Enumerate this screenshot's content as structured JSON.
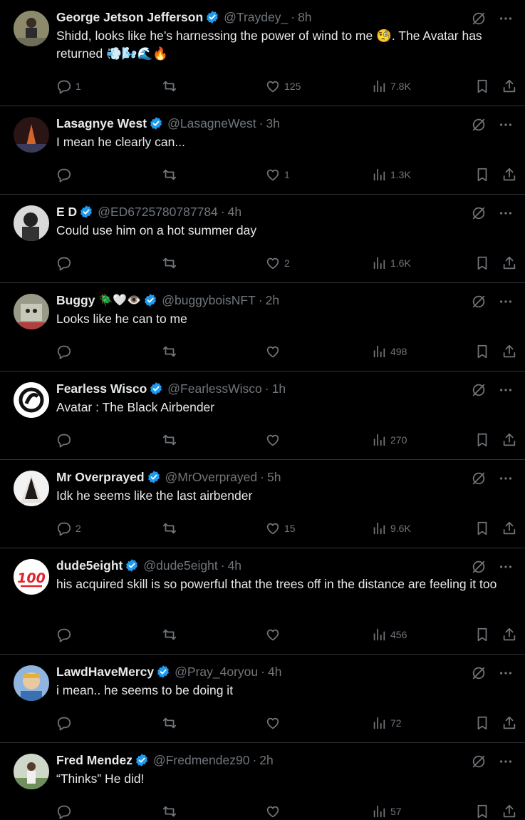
{
  "tweets": [
    {
      "name": "George Jetson Jefferson",
      "handle": "@Traydey_",
      "time": "8h",
      "name_emoji": "",
      "text": "Shidd, looks like he’s harnessing the power of wind to me 🧐.  The Avatar has returned 💨🌬️🌊🔥",
      "replies": "1",
      "retweets": "",
      "likes": "125",
      "views": "7.8K",
      "avatar_color": "#6b6b55"
    },
    {
      "name": "Lasagnye West",
      "handle": "@LasagneWest",
      "time": "3h",
      "name_emoji": "",
      "text": "I mean he clearly can...",
      "replies": "",
      "retweets": "",
      "likes": "1",
      "views": "1.3K",
      "avatar_color": "#3a2a2a"
    },
    {
      "name": "E D",
      "handle": "@ED6725780787784",
      "time": "4h",
      "name_emoji": "",
      "text": "Could use him on a hot summer day",
      "replies": "",
      "retweets": "",
      "likes": "2",
      "views": "1.6K",
      "avatar_color": "#444"
    },
    {
      "name": "Buggy",
      "handle": "@buggyboisNFT",
      "time": "2h",
      "name_emoji": "🪲🤍👁️",
      "text": "Looks like he can to me",
      "replies": "",
      "retweets": "",
      "likes": "",
      "views": "498",
      "avatar_color": "#8a8a7a"
    },
    {
      "name": "Fearless Wisco",
      "handle": "@FearlessWisco",
      "time": "1h",
      "name_emoji": "",
      "text": "Avatar : The Black Airbender",
      "replies": "",
      "retweets": "",
      "likes": "",
      "views": "270",
      "avatar_color": "#fff"
    },
    {
      "name": "Mr Overprayed",
      "handle": "@MrOverprayed",
      "time": "5h",
      "name_emoji": "",
      "text": "Idk he seems like the last airbender",
      "replies": "2",
      "retweets": "",
      "likes": "15",
      "views": "9.6K",
      "avatar_color": "#ddd"
    },
    {
      "name": "dude5eight",
      "handle": "@dude5eight",
      "time": "4h",
      "name_emoji": "",
      "text": "his acquired skill is so powerful that the trees off in the distance are feeling it too",
      "replies": "",
      "retweets": "",
      "likes": "",
      "views": "456",
      "avatar_color": "#fff"
    },
    {
      "name": "LawdHaveMercy",
      "handle": "@Pray_4oryou",
      "time": "4h",
      "name_emoji": "",
      "text": "i mean.. he seems to be doing it",
      "replies": "",
      "retweets": "",
      "likes": "",
      "views": "72",
      "avatar_color": "#7fa7d8"
    },
    {
      "name": "Fred Mendez",
      "handle": "@Fredmendez90",
      "time": "2h",
      "name_emoji": "",
      "text": "“Thinks” He did!",
      "replies": "",
      "retweets": "",
      "likes": "",
      "views": "57",
      "avatar_color": "#ccc"
    }
  ],
  "icons": {
    "verified": "verified-badge-icon",
    "grok": "grok-icon",
    "more": "more-icon",
    "reply": "reply-icon",
    "retweet": "retweet-icon",
    "like": "like-icon",
    "views": "views-icon",
    "bookmark": "bookmark-icon",
    "share": "share-icon"
  },
  "colors": {
    "background": "#000000",
    "text": "#e7e9ea",
    "muted": "#71767b",
    "divider": "#2f3336",
    "verified": "#1d9bf0"
  }
}
